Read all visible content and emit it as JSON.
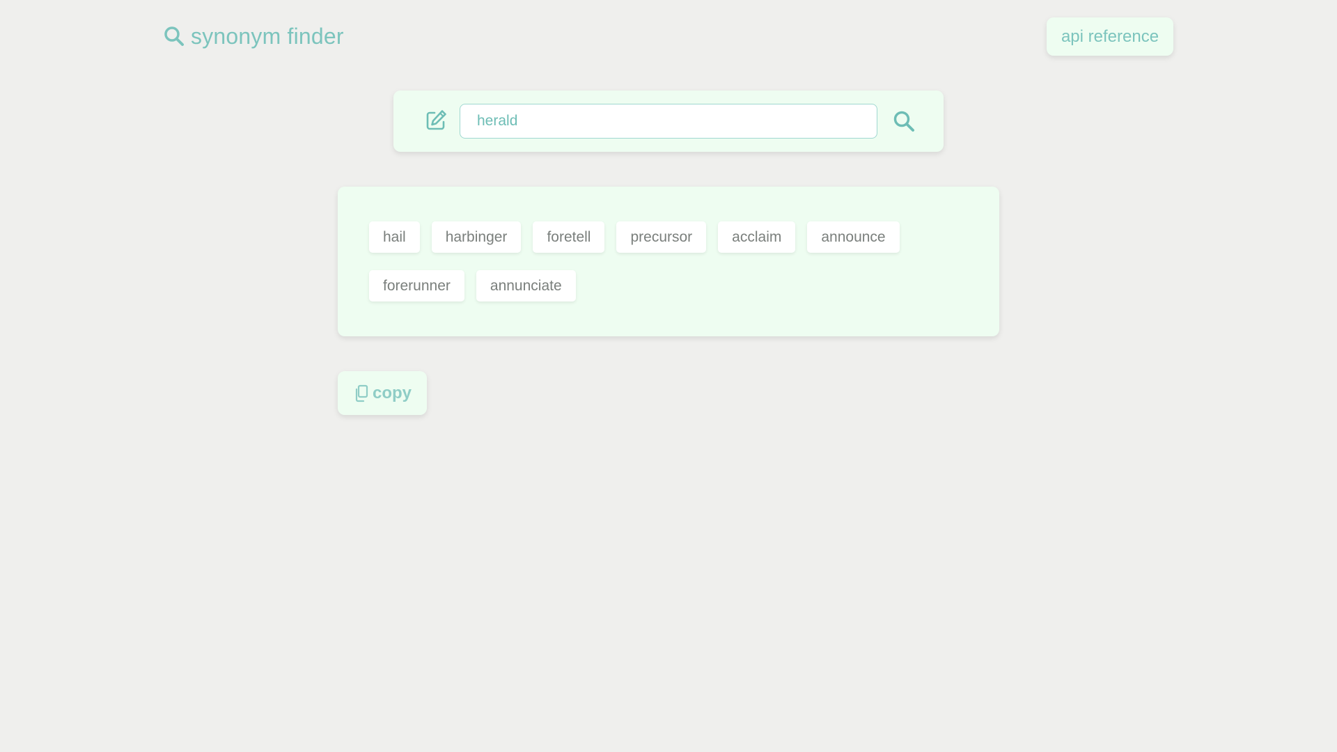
{
  "header": {
    "brand_icon": "search-icon",
    "title": "synonym finder",
    "api_button_label": "api reference"
  },
  "search": {
    "edit_icon": "edit-icon",
    "value": "herald",
    "submit_icon": "search-icon"
  },
  "results": {
    "synonyms": [
      "hail",
      "harbinger",
      "foretell",
      "precursor",
      "acclaim",
      "announce",
      "forerunner",
      "annunciate"
    ]
  },
  "actions": {
    "copy_icon": "copy-icon",
    "copy_label": "copy"
  },
  "colors": {
    "background": "#efefed",
    "card": "#eefdf1",
    "accent": "#7cc4bd",
    "chip_text": "#7a7f7c"
  }
}
